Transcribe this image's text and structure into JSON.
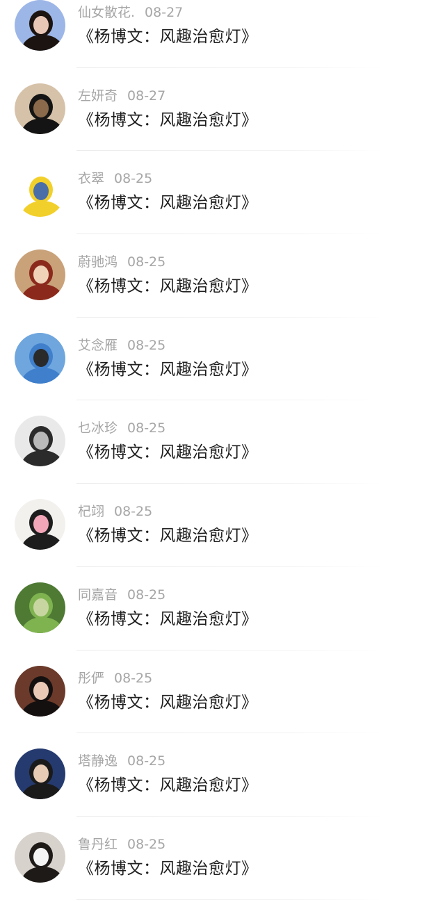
{
  "comments": [
    {
      "username": "仙女散花.",
      "date": "08-27",
      "content": "《杨博文：风趣治愈灯》",
      "avatar_colors": [
        "#9db6e8",
        "#1b1410",
        "#e9c7b6"
      ]
    },
    {
      "username": "左妍奇",
      "date": "08-27",
      "content": "《杨博文：风趣治愈灯》",
      "avatar_colors": [
        "#d6c2a8",
        "#141414",
        "#8a6a4a"
      ]
    },
    {
      "username": "衣翠",
      "date": "08-25",
      "content": "《杨博文：风趣治愈灯》",
      "avatar_colors": [
        "#ffffff",
        "#f2d02b",
        "#4a6fa8"
      ]
    },
    {
      "username": "蔚驰鸿",
      "date": "08-25",
      "content": "《杨博文：风趣治愈灯》",
      "avatar_colors": [
        "#c9a27a",
        "#8b2a1c",
        "#f0d2b8"
      ]
    },
    {
      "username": "艾念雁",
      "date": "08-25",
      "content": "《杨博文：风趣治愈灯》",
      "avatar_colors": [
        "#6fa6de",
        "#3f7fcb",
        "#2a2a2a"
      ]
    },
    {
      "username": "乜冰珍",
      "date": "08-25",
      "content": "《杨博文：风趣治愈灯》",
      "avatar_colors": [
        "#e9e9e9",
        "#2b2b2b",
        "#b9b9b9"
      ]
    },
    {
      "username": "杞翊",
      "date": "08-25",
      "content": "《杨博文：风趣治愈灯》",
      "avatar_colors": [
        "#f3f1ee",
        "#1d1d1d",
        "#f3a6b8"
      ]
    },
    {
      "username": "同嘉音",
      "date": "08-25",
      "content": "《杨博文：风趣治愈灯》",
      "avatar_colors": [
        "#4e7a34",
        "#7fb350",
        "#c7d6a0"
      ]
    },
    {
      "username": "彤俨",
      "date": "08-25",
      "content": "《杨博文：风趣治愈灯》",
      "avatar_colors": [
        "#6b3a2a",
        "#151010",
        "#e9c9b5"
      ]
    },
    {
      "username": "塔静逸",
      "date": "08-25",
      "content": "《杨博文：风趣治愈灯》",
      "avatar_colors": [
        "#253a6e",
        "#1a1a1a",
        "#e7cbb4"
      ]
    },
    {
      "username": "鲁丹红",
      "date": "08-25",
      "content": "《杨博文：风趣治愈灯》",
      "avatar_colors": [
        "#d8d2cc",
        "#1e1a18",
        "#f4f4f4"
      ]
    }
  ]
}
